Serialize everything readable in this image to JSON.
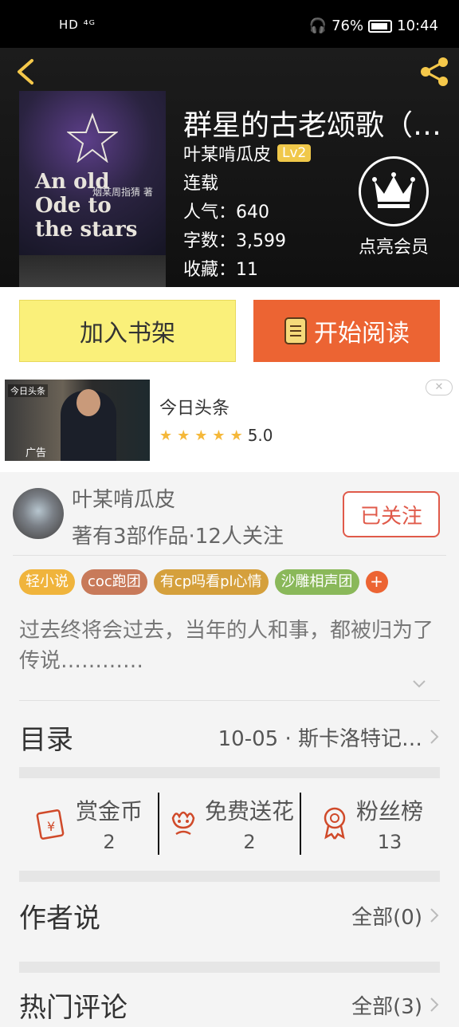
{
  "status_bar": {
    "left": "HD ⁴ᴳ",
    "battery": "76%",
    "time": "10:44"
  },
  "book": {
    "title": "群星的古老颂歌（…",
    "author": "叶某啃瓜皮",
    "level": "Lv2",
    "status": "连载",
    "popularity": "人气：640",
    "word_count": "字数：3,599",
    "favorites": "收藏：11",
    "cover_title": "An old Ode to the stars",
    "cover_cn": "烟某周指猜 著"
  },
  "vip": {
    "label": "点亮会员"
  },
  "actions": {
    "shelf": "加入书架",
    "read": "开始阅读"
  },
  "ad": {
    "name": "今日头条",
    "rating": "5.0",
    "label": "广告",
    "brand": "今日头条"
  },
  "author_card": {
    "name": "叶某啃瓜皮",
    "stats": "著有3部作品·12人关注",
    "follow": "已关注"
  },
  "tags": [
    {
      "label": "轻小说",
      "color": "#f0b43c"
    },
    {
      "label": "coc跑团",
      "color": "#c87a5a"
    },
    {
      "label": "有cp吗看pl心情",
      "color": "#d5a03c"
    },
    {
      "label": "沙雕相声团",
      "color": "#8ab85a"
    }
  ],
  "tag_more": "+",
  "synopsis": "过去终将会过去，当年的人和事，都被归为了传说…………",
  "catalog": {
    "label": "目录",
    "latest": "10-05 · 斯卡洛特记…"
  },
  "stats": [
    {
      "label": "赏金币",
      "value": "2",
      "icon": "gift-card-icon"
    },
    {
      "label": "免费送花",
      "value": "2",
      "icon": "flower-icon"
    },
    {
      "label": "粉丝榜",
      "value": "13",
      "icon": "medal-icon"
    }
  ],
  "author_says": {
    "label": "作者说",
    "all": "全部(0)"
  },
  "hot_comments": {
    "label": "热门评论",
    "all": "全部(3)"
  },
  "colors": {
    "accent_orange": "#ec6433",
    "shelf_yellow": "#faf07a",
    "follow_red": "#e05a4a",
    "level_gold": "#f0c84a"
  }
}
